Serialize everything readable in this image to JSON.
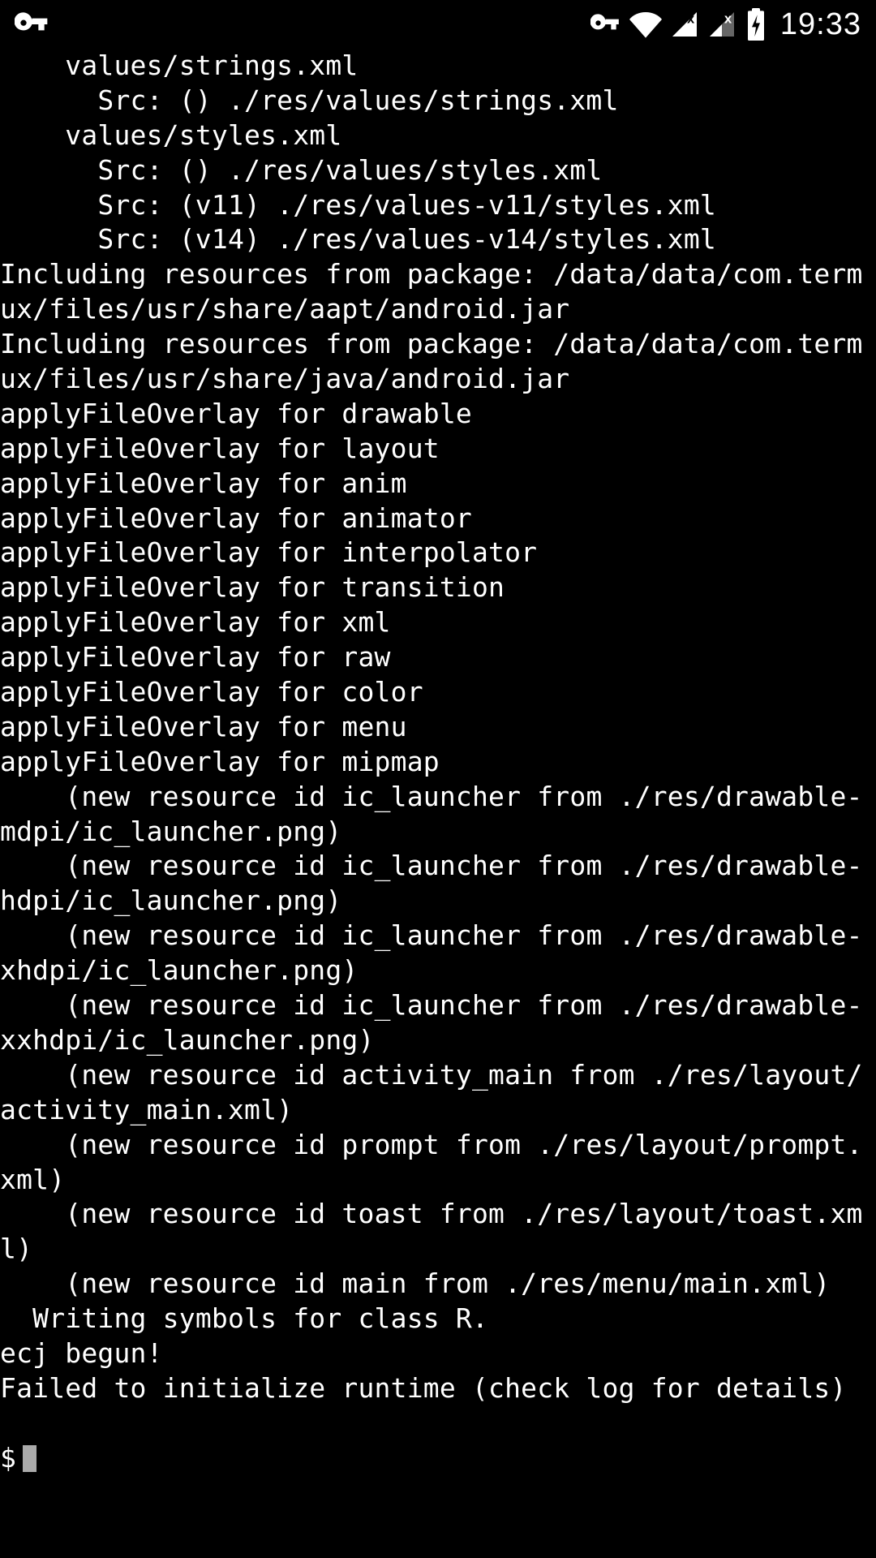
{
  "status_bar": {
    "clock": "19:33"
  },
  "terminal": {
    "lines": [
      "    values/strings.xml",
      "      Src: () ./res/values/strings.xml",
      "    values/styles.xml",
      "      Src: () ./res/values/styles.xml",
      "      Src: (v11) ./res/values-v11/styles.xml",
      "      Src: (v14) ./res/values-v14/styles.xml",
      "Including resources from package: /data/data/com.termux/files/usr/share/aapt/android.jar",
      "Including resources from package: /data/data/com.termux/files/usr/share/java/android.jar",
      "applyFileOverlay for drawable",
      "applyFileOverlay for layout",
      "applyFileOverlay for anim",
      "applyFileOverlay for animator",
      "applyFileOverlay for interpolator",
      "applyFileOverlay for transition",
      "applyFileOverlay for xml",
      "applyFileOverlay for raw",
      "applyFileOverlay for color",
      "applyFileOverlay for menu",
      "applyFileOverlay for mipmap",
      "    (new resource id ic_launcher from ./res/drawable-mdpi/ic_launcher.png)",
      "    (new resource id ic_launcher from ./res/drawable-hdpi/ic_launcher.png)",
      "    (new resource id ic_launcher from ./res/drawable-xhdpi/ic_launcher.png)",
      "    (new resource id ic_launcher from ./res/drawable-xxhdpi/ic_launcher.png)",
      "    (new resource id activity_main from ./res/layout/activity_main.xml)",
      "    (new resource id prompt from ./res/layout/prompt.xml)",
      "    (new resource id toast from ./res/layout/toast.xml)",
      "    (new resource id main from ./res/menu/main.xml)",
      "  Writing symbols for class R.",
      "ecj begun!",
      "Failed to initialize runtime (check log for details)"
    ],
    "prompt": "$"
  }
}
